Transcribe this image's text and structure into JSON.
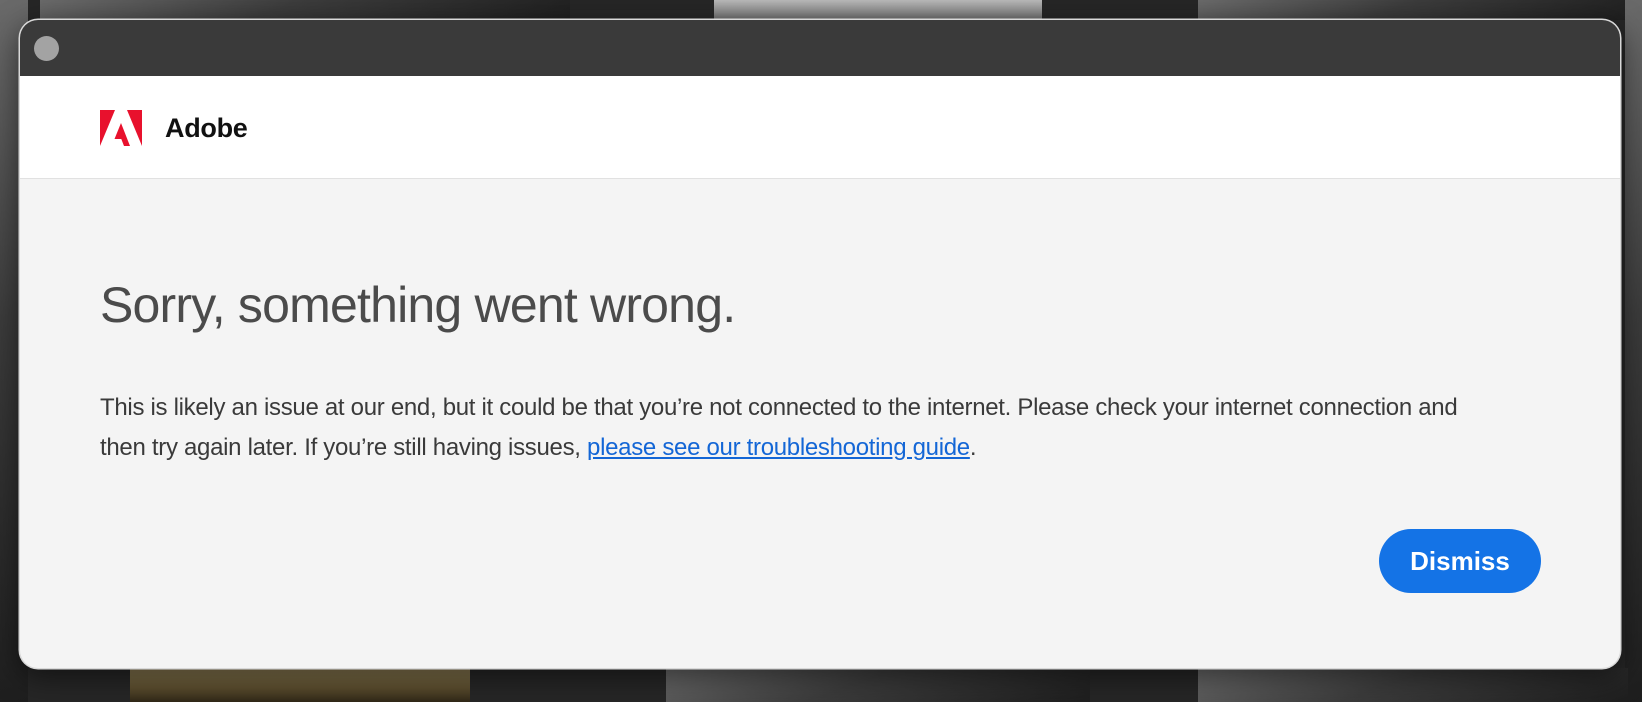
{
  "window": {
    "close_button": "close"
  },
  "header": {
    "brand_name": "Adobe",
    "logo_icon": "adobe-logo-icon",
    "logo_color": "#e8112d"
  },
  "error": {
    "heading": "Sorry, something went wrong.",
    "message_before_link": "This is likely an issue at our end, but it could be that you’re not connected to the internet. Please check your internet connection and then try again later. If you’re still having issues, ",
    "link_text": "please see our troubleshooting guide",
    "message_after_link": "."
  },
  "actions": {
    "dismiss_label": "Dismiss"
  },
  "colors": {
    "accent": "#1473e6",
    "link": "#1366d6",
    "titlebar": "#3a3a3a"
  }
}
